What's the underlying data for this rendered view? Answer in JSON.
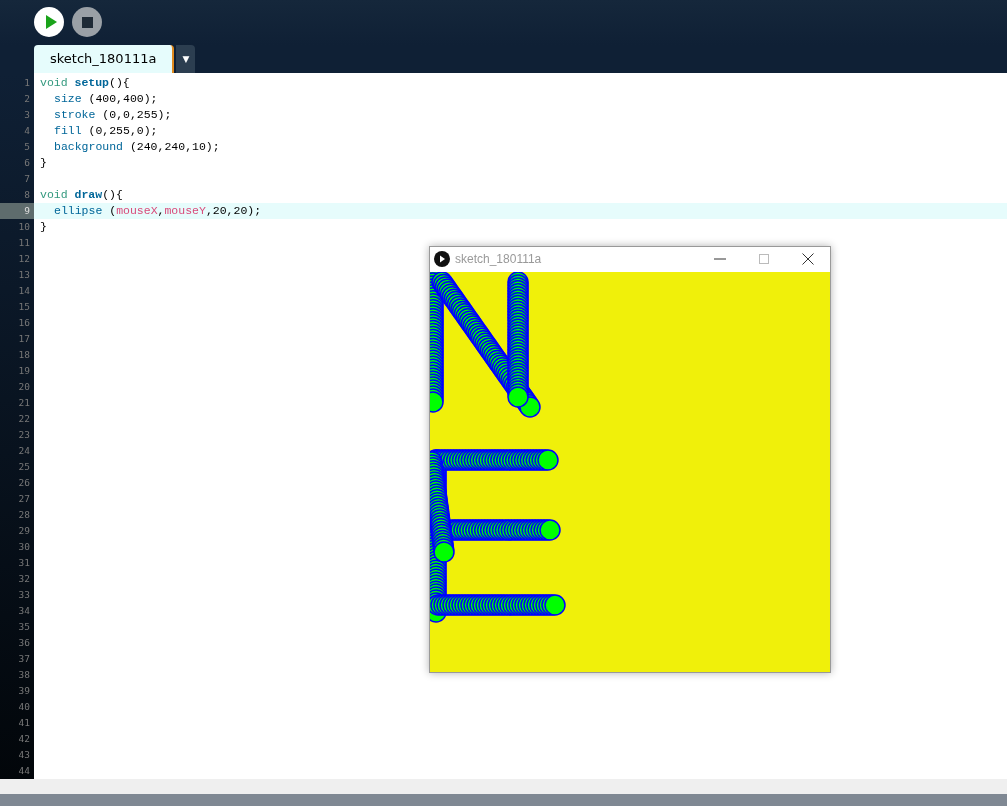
{
  "toolbar": {
    "buttons": [
      {
        "kind": "run"
      },
      {
        "kind": "stop"
      }
    ]
  },
  "tabs": [
    {
      "label": "sketch_180111a",
      "selected": true
    }
  ],
  "tab_menu": {
    "label": "▼"
  },
  "editor": {
    "lines": [
      {
        "current": false,
        "tokens": [
          {
            "kind": "keyword",
            "text": "void "
          },
          {
            "kind": "function",
            "text": "setup"
          },
          {
            "kind": "plain",
            "text": "(){"
          }
        ],
        "children": [
          {
            "current": false,
            "tokens": [
              {
                "kind": "builtin",
                "text": "size"
              },
              {
                "kind": "plain",
                "text": " (400,400);"
              }
            ]
          },
          {
            "current": false,
            "tokens": [
              {
                "kind": "builtin",
                "text": "stroke"
              },
              {
                "kind": "plain",
                "text": " (0,0,255);"
              }
            ]
          },
          {
            "current": false,
            "tokens": [
              {
                "kind": "builtin",
                "text": "fill"
              },
              {
                "kind": "plain",
                "text": " (0,255,0);"
              }
            ]
          },
          {
            "current": false,
            "tokens": [
              {
                "kind": "builtin",
                "text": "background"
              },
              {
                "kind": "plain",
                "text": " (240,240,10);"
              }
            ]
          }
        ]
      },
      {
        "current": false,
        "tokens": [
          {
            "kind": "plain",
            "text": "}"
          }
        ]
      },
      {
        "current": false
      },
      {
        "current": false,
        "tokens": [
          {
            "kind": "keyword",
            "text": "void "
          },
          {
            "kind": "function",
            "text": "draw"
          },
          {
            "kind": "plain",
            "text": "(){"
          }
        ],
        "children": [
          {
            "current": true,
            "tokens": [
              {
                "kind": "builtin",
                "text": "ellipse"
              },
              {
                "kind": "plain",
                "text": " ("
              },
              {
                "kind": "variable",
                "text": "mouseX"
              },
              {
                "kind": "plain",
                "text": ","
              },
              {
                "kind": "variable",
                "text": "mouseY"
              },
              {
                "kind": "plain",
                "text": ",20,20);"
              }
            ]
          }
        ]
      },
      {
        "current": false,
        "tokens": [
          {
            "kind": "plain",
            "text": "}"
          }
        ]
      }
    ],
    "line_numbers": [
      "1",
      "2",
      "3",
      "4",
      "5",
      "6",
      "7",
      "8",
      "9",
      "10",
      "11",
      "12",
      "13",
      "14",
      "15",
      "16",
      "17",
      "18",
      "19",
      "20",
      "21",
      "22",
      "23",
      "24",
      "25",
      "26",
      "27",
      "28",
      "29",
      "30",
      "31",
      "32",
      "33",
      "34",
      "35",
      "36",
      "37",
      "38",
      "39",
      "40",
      "41",
      "42",
      "43",
      "44"
    ]
  },
  "sketch_window": {
    "title": "sketch_180111a"
  }
}
